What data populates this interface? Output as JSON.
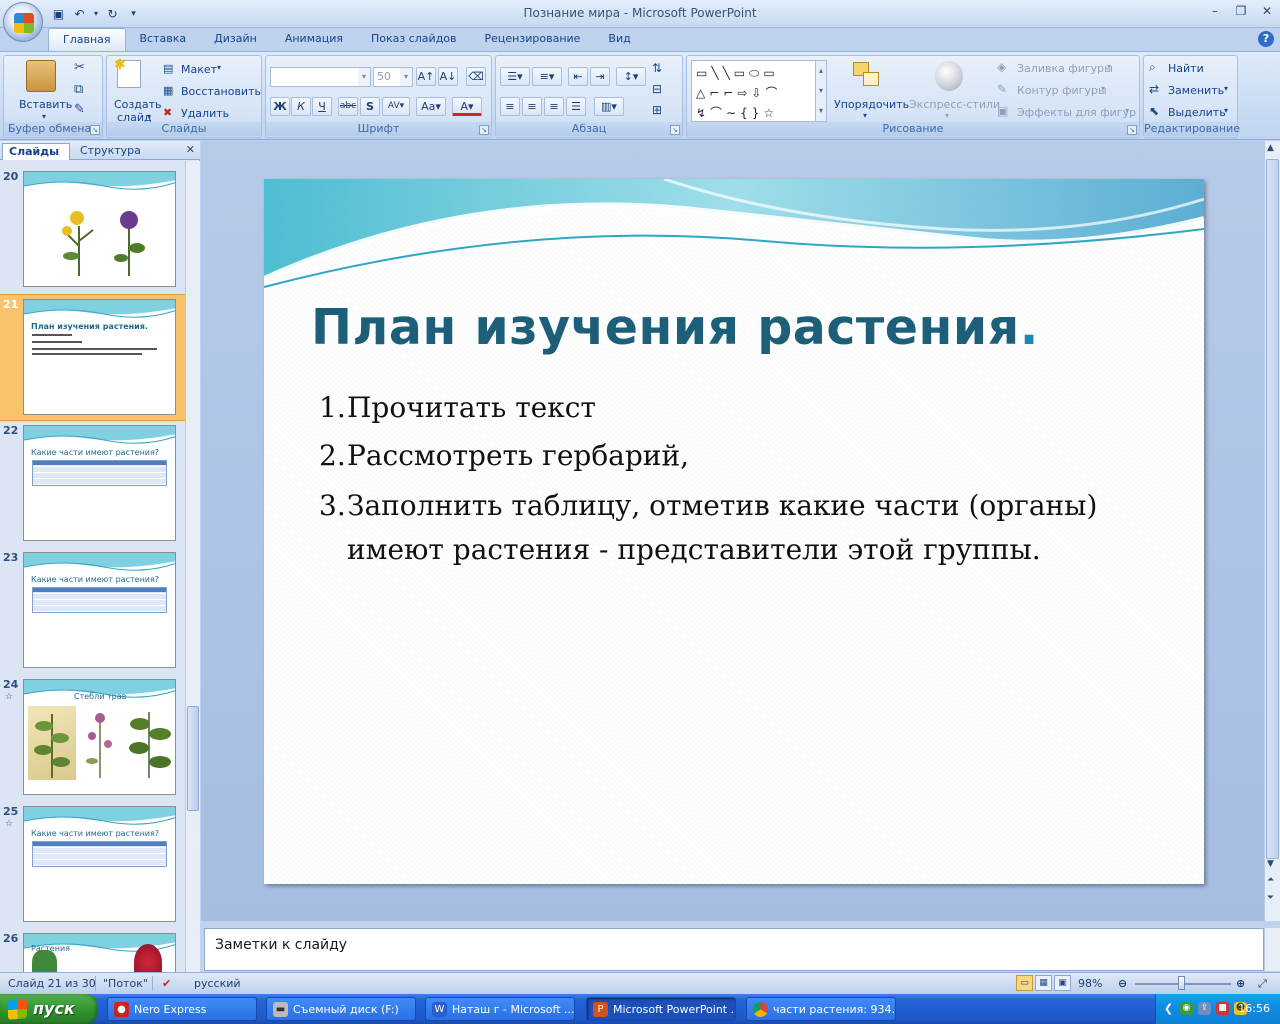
{
  "window": {
    "title": "Познание мира - Microsoft PowerPoint"
  },
  "ribbon_tabs": [
    "Главная",
    "Вставка",
    "Дизайн",
    "Анимация",
    "Показ слайдов",
    "Рецензирование",
    "Вид"
  ],
  "ribbon": {
    "clipboard": {
      "paste": "Вставить",
      "label": "Буфер обмена"
    },
    "slides": {
      "new_slide_1": "Создать",
      "new_slide_2": "слайд",
      "layout": "Макет",
      "reset": "Восстановить",
      "delete": "Удалить",
      "label": "Слайды"
    },
    "font": {
      "font_size": "50",
      "label": "Шрифт"
    },
    "paragraph": {
      "label": "Абзац"
    },
    "drawing": {
      "arrange": "Упорядочить",
      "quick_styles": "Экспресс-стили",
      "shape_fill": "Заливка фигуры",
      "shape_outline": "Контур фигуры",
      "shape_effects": "Эффекты для фигур",
      "label": "Рисование"
    },
    "editing": {
      "find": "Найти",
      "replace": "Заменить",
      "select": "Выделить",
      "label": "Редактирование"
    }
  },
  "left_pane": {
    "tab_slides": "Слайды",
    "tab_outline": "Структура",
    "thumbnails": [
      {
        "num": "20",
        "title": ""
      },
      {
        "num": "21",
        "title": "План изучения растения."
      },
      {
        "num": "22",
        "title": "Какие части имеют растения?"
      },
      {
        "num": "23",
        "title": "Какие части имеют растения?"
      },
      {
        "num": "24",
        "title": "Стебли трав"
      },
      {
        "num": "25",
        "title": "Какие части имеют растения?"
      },
      {
        "num": "26",
        "title": "Растения"
      }
    ]
  },
  "slide": {
    "title": "План изучения растения",
    "title_end": ".",
    "items": [
      {
        "num": "1.",
        "text": "Прочитать текст"
      },
      {
        "num": "2.",
        "text": "Рассмотреть гербарий,"
      },
      {
        "num": "3.",
        "text": "Заполнить таблицу, отметив какие части (органы) имеют растения - представители этой группы."
      }
    ]
  },
  "notes": {
    "placeholder": "Заметки к слайду"
  },
  "status": {
    "slide_info": "Слайд 21 из 30",
    "theme": "\"Поток\"",
    "language": "русский",
    "zoom": "98%"
  },
  "taskbar": {
    "start": "пуск",
    "tasks": [
      "Nero Express",
      "Съемный диск (F:)",
      "Наташ г - Microsoft ...",
      "Microsoft PowerPoint ...",
      "части растения: 934..."
    ],
    "clock": "16:56"
  },
  "colors": {
    "slide_title": "#1d5f78",
    "ribbon_bg": "#dfeafa",
    "selected_thumb": "#f8c36b"
  }
}
